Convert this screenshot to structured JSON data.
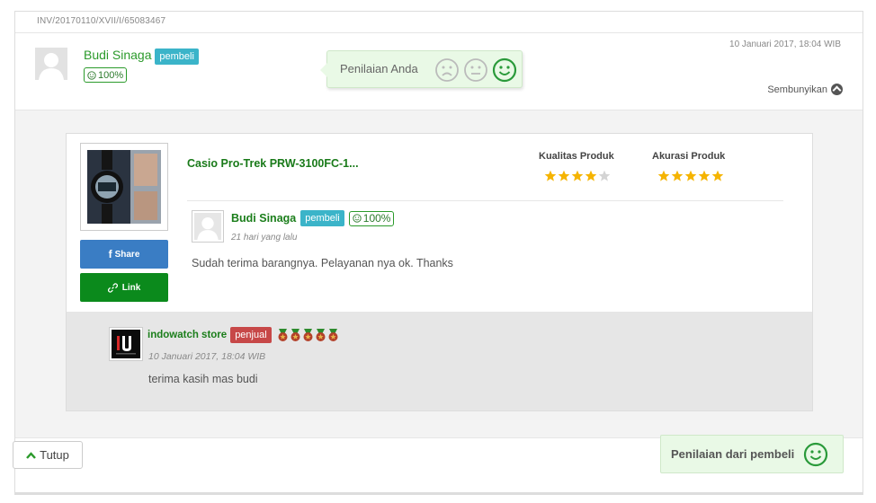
{
  "header": {
    "invoice_id": "INV/20170110/XVII/I/65083467",
    "datetime": "10 Januari 2017, 18:04 WIB",
    "buyer_name": "Budi Sinaga",
    "buyer_badge": "pembeli",
    "buyer_score": "100%",
    "hide_label": "Sembunyikan"
  },
  "rating_prompt": {
    "label": "Penilaian Anda",
    "faces": [
      "sad-face-icon",
      "neutral-face-icon",
      "happy-face-icon"
    ],
    "selected": "happy-face-icon"
  },
  "product": {
    "name": "Casio Pro-Trek PRW-3100FC-1...",
    "quality_label": "Kualitas Produk",
    "quality_rating": 4,
    "accuracy_label": "Akurasi Produk",
    "accuracy_rating": 5,
    "share_label": "Share",
    "link_label": "Link"
  },
  "review": {
    "author": "Budi Sinaga",
    "badge": "pembeli",
    "score": "100%",
    "time": "21 hari yang lalu",
    "text": "Sudah terima barangnya. Pelayanan nya ok. Thanks"
  },
  "reply": {
    "seller": "indowatch store",
    "badge": "penjual",
    "medal_count": 5,
    "time": "10 Januari 2017, 18:04 WIB",
    "text": "terima kasih mas budi"
  },
  "footer": {
    "top_label": "Tutup",
    "buyer_rating_label": "Penilaian dari pembeli"
  },
  "colors": {
    "green": "#1b7e1b",
    "teal_badge": "#3bb4c9",
    "seller_badge": "#c74848",
    "share_blue": "#3a7dc4",
    "link_green": "#0b8a1c",
    "rating_bg": "#e9f9e6",
    "star": "#f5b400"
  }
}
